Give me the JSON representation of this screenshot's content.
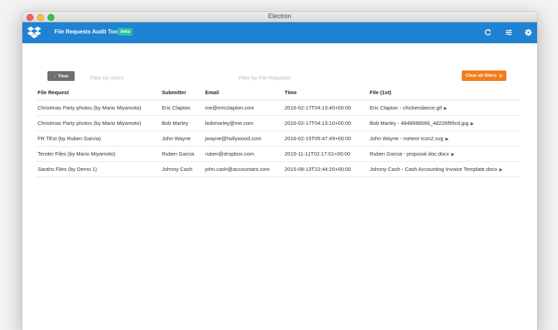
{
  "window": {
    "title": "Electron"
  },
  "appbar": {
    "title": "File Requests Audit Tool",
    "badge": "beta",
    "color": "#1f82d2"
  },
  "filters": {
    "time_label": "Time",
    "users_placeholder": "Filter by Users",
    "requests_placeholder": "Filter by File Requests",
    "clear_label": "Clear all filters",
    "clear_icon": "✕",
    "sort_icon": "↓"
  },
  "table": {
    "headers": [
      "File Request",
      "Submitter",
      "Email",
      "Time",
      "File (1st)"
    ],
    "rows": [
      [
        "Christmas Party photos (by Mario Miyamoto)",
        "Eric Clapton",
        "me@ericclapton.com",
        "2016-02-17T04:13:40+00:00",
        "Eric Clapton - chickendance.gif"
      ],
      [
        "Christmas Party photos (by Mario Miyamoto)",
        "Bob Marley",
        "bobmarley@me.com",
        "2016-02-17T04:13:10+00:00",
        "Bob Marley - 4848998566_4d226f95cd.jpg"
      ],
      [
        "FR TEst (by Ruben Garcia)",
        "John Wayne",
        "jwayne@hollywood.com",
        "2016-02-15T05:47:49+00:00",
        "John Wayne - meteor-icon2.svg"
      ],
      [
        "Tender Files (by Mario Miyamoto)",
        "Ruben Garcia",
        "ruben@dropbox.com",
        "2015-11-11T02:17:01+00:00",
        "Ruben Garcia - proposal doc.docx"
      ],
      [
        "Sarahs Files (by Demo 1)",
        "Johnny Cash",
        "john.cash@accountant.com",
        "2015-08-13T22:44:20+00:00",
        "Johnny Cash - Cash Accounting Invoice Template.docx"
      ]
    ]
  },
  "icons": {
    "logo": "dropbox-logo-icon",
    "refresh": "refresh-icon",
    "filter": "sliders-icon",
    "settings": "gear-icon"
  },
  "colors": {
    "beta": "#26c0a6",
    "clear_button": "#f27e1a",
    "time_button": "#6f6f6f"
  }
}
